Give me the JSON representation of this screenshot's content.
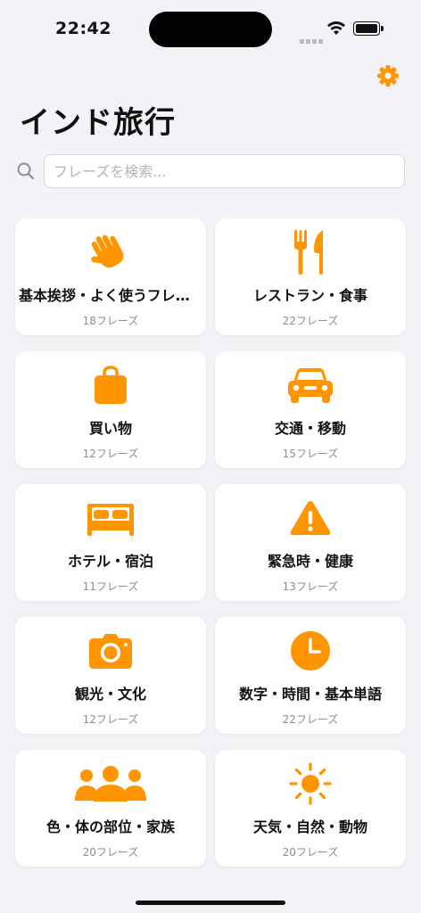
{
  "status": {
    "time": "22:42"
  },
  "header": {
    "title": "インド旅行",
    "settings_icon": "gear-icon",
    "accent": "#ff9500"
  },
  "search": {
    "placeholder": "フレーズを検索..."
  },
  "categories": [
    {
      "label": "基本挨拶・よく使うフレーズ",
      "count": "18フレーズ",
      "icon": "waving-hand-icon"
    },
    {
      "label": "レストラン・食事",
      "count": "22フレーズ",
      "icon": "fork-knife-icon"
    },
    {
      "label": "買い物",
      "count": "12フレーズ",
      "icon": "shopping-bag-icon"
    },
    {
      "label": "交通・移動",
      "count": "15フレーズ",
      "icon": "car-icon"
    },
    {
      "label": "ホテル・宿泊",
      "count": "11フレーズ",
      "icon": "bed-icon"
    },
    {
      "label": "緊急時・健康",
      "count": "13フレーズ",
      "icon": "warning-icon"
    },
    {
      "label": "観光・文化",
      "count": "12フレーズ",
      "icon": "camera-icon"
    },
    {
      "label": "数字・時間・基本単語",
      "count": "22フレーズ",
      "icon": "clock-icon"
    },
    {
      "label": "色・体の部位・家族",
      "count": "20フレーズ",
      "icon": "people-icon"
    },
    {
      "label": "天気・自然・動物",
      "count": "20フレーズ",
      "icon": "sun-icon"
    }
  ]
}
